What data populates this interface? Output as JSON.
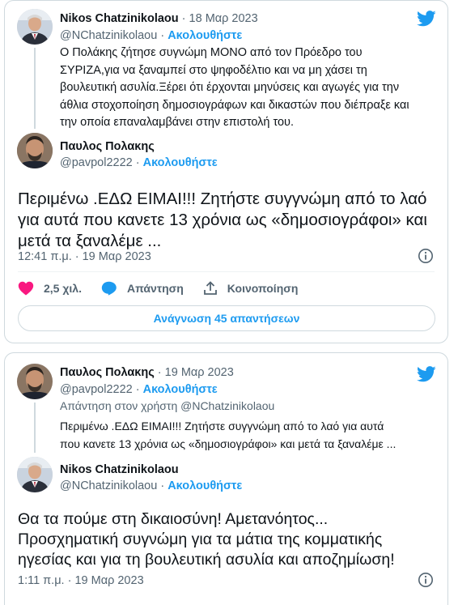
{
  "colors": {
    "accent": "#1d9bf0",
    "like": "#f91880",
    "muted": "#536471",
    "text": "#0f1419"
  },
  "tweet1": {
    "quoted": {
      "author_name": "Nikos Chatzinikolaou",
      "date": "18 Μαρ 2023",
      "handle": "@NChatzinikolaou",
      "follow_label": "Ακολουθήστε",
      "text_lines": [
        "Ο Πολάκης ζήτησε συγνώμη ΜΟΝΟ από τον Πρόεδρο του",
        "ΣΥΡΙΖΑ,για να ξαναμπεί στο ψηφοδέλτιο και να μη χάσει τη",
        "βουλευτική ασυλία.Ξέρει ότι έρχονται μηνύσεις και αγωγές για την",
        "άθλια στοχοποίηση δημοσιογράφων και δικαστών που διέπραξε και",
        "την οποία επαναλαμβάνει στην επιστολή του."
      ]
    },
    "main": {
      "author_name": "Παυλος Πολακης",
      "handle": "@pavpol2222",
      "follow_label": "Ακολουθήστε",
      "text_lines": [
        "Περιμένω .ΕΔΩ ΕΙΜΑΙ!!! Ζητήστε συγγνώμη από το λαό",
        "για αυτά που κανετε 13 χρόνια ως «δημοσιογράφοι» και",
        "μετά τα ξαναλέμε ..."
      ],
      "timestamp": "12:41 π.μ. · 19 Μαρ 2023"
    },
    "actions": {
      "like_count": "2,5 χιλ.",
      "reply_label": "Απάντηση",
      "share_label": "Κοινοποίηση"
    },
    "read_replies_label": "Ανάγνωση 45 απαντήσεων"
  },
  "tweet2": {
    "parent": {
      "author_name": "Παυλος Πολακης",
      "date": "19 Μαρ 2023",
      "handle": "@pavpol2222",
      "follow_label": "Ακολουθήστε",
      "reply_to_prefix": "Απάντηση στον χρήστη",
      "reply_to_handle": "@NChatzinikolaou",
      "text_lines": [
        "Περιμένω .ΕΔΩ ΕΙΜΑΙ!!! Ζητήστε συγγνώμη από το λαό για αυτά",
        "που κανετε 13 χρόνια ως «δημοσιογράφοι» και μετά τα ξαναλέμε ..."
      ]
    },
    "main": {
      "author_name": "Nikos Chatzinikolaou",
      "handle": "@NChatzinikolaou",
      "follow_label": "Ακολουθήστε",
      "text_lines": [
        "Θα τα πούμε στη δικαιοσύνη! Αμετανόητος...",
        "Προσχηματική συγνώμη για τα μάτια της κομματικής",
        "ηγεσίας και για τη βουλευτική ασυλία και αποζημίωση!"
      ],
      "timestamp": "1:11 π.μ. · 19 Μαρ 2023"
    }
  }
}
